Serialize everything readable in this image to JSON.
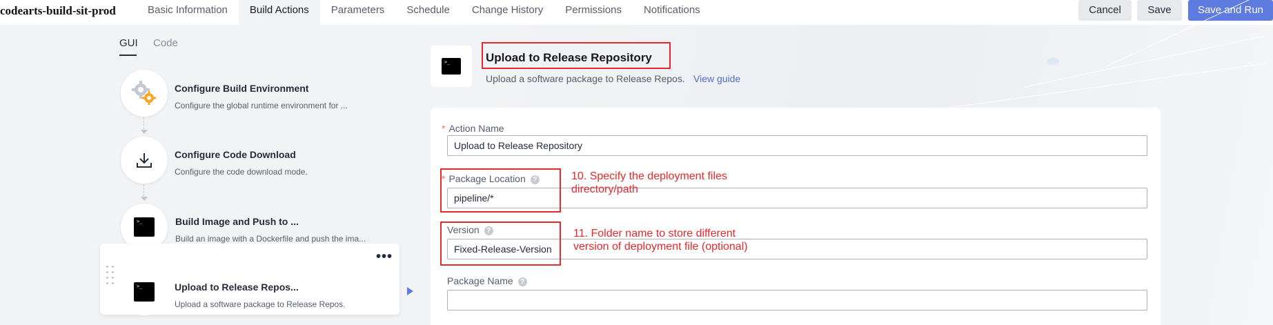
{
  "app": {
    "title": "codearts-build-sit-prod"
  },
  "tabs": [
    {
      "label": "Basic Information"
    },
    {
      "label": "Build Actions"
    },
    {
      "label": "Parameters"
    },
    {
      "label": "Schedule"
    },
    {
      "label": "Change History"
    },
    {
      "label": "Permissions"
    },
    {
      "label": "Notifications"
    }
  ],
  "active_tab": "Build Actions",
  "actions": {
    "cancel": "Cancel",
    "save": "Save",
    "save_run": "Save and Run"
  },
  "mode_tabs": {
    "gui": "GUI",
    "code": "Code"
  },
  "steps": [
    {
      "title": "Configure Build Environment",
      "desc": "Configure the global runtime environment for ...",
      "icon": "gear-icon"
    },
    {
      "title": "Configure Code Download",
      "desc": "Configure the code download mode.",
      "icon": "download-icon"
    },
    {
      "title": "Build Image and Push to ...",
      "desc": "Build an image with a Dockerfile and push the ima...",
      "icon": "terminal-icon"
    },
    {
      "title": "Upload to Release Repos...",
      "desc": "Upload a software package to Release Repos.",
      "icon": "terminal-icon"
    }
  ],
  "terminal_glyph": ">_",
  "more_label": "•••",
  "detail": {
    "title": "Upload to Release Repository",
    "description": "Upload a software package to Release Repos.",
    "guide_link": "View guide"
  },
  "form": {
    "required_mark": "*",
    "help_glyph": "?",
    "action_name": {
      "label": "Action Name",
      "value": "Upload to Release Repository"
    },
    "package_location": {
      "label": "Package Location",
      "value": "pipeline/*"
    },
    "version": {
      "label": "Version",
      "value": "Fixed-Release-Version"
    },
    "package_name": {
      "label": "Package Name",
      "value": ""
    }
  },
  "annotations": {
    "note10": {
      "line1": "10. Specify the deployment files",
      "line2": "directory/path"
    },
    "note11": {
      "line1": "11. Folder name to store different",
      "line2": "version of deployment file (optional)"
    }
  },
  "colors": {
    "primary": "#5e7ce0",
    "annotation": "#e8282b",
    "link": "#526ecc"
  }
}
